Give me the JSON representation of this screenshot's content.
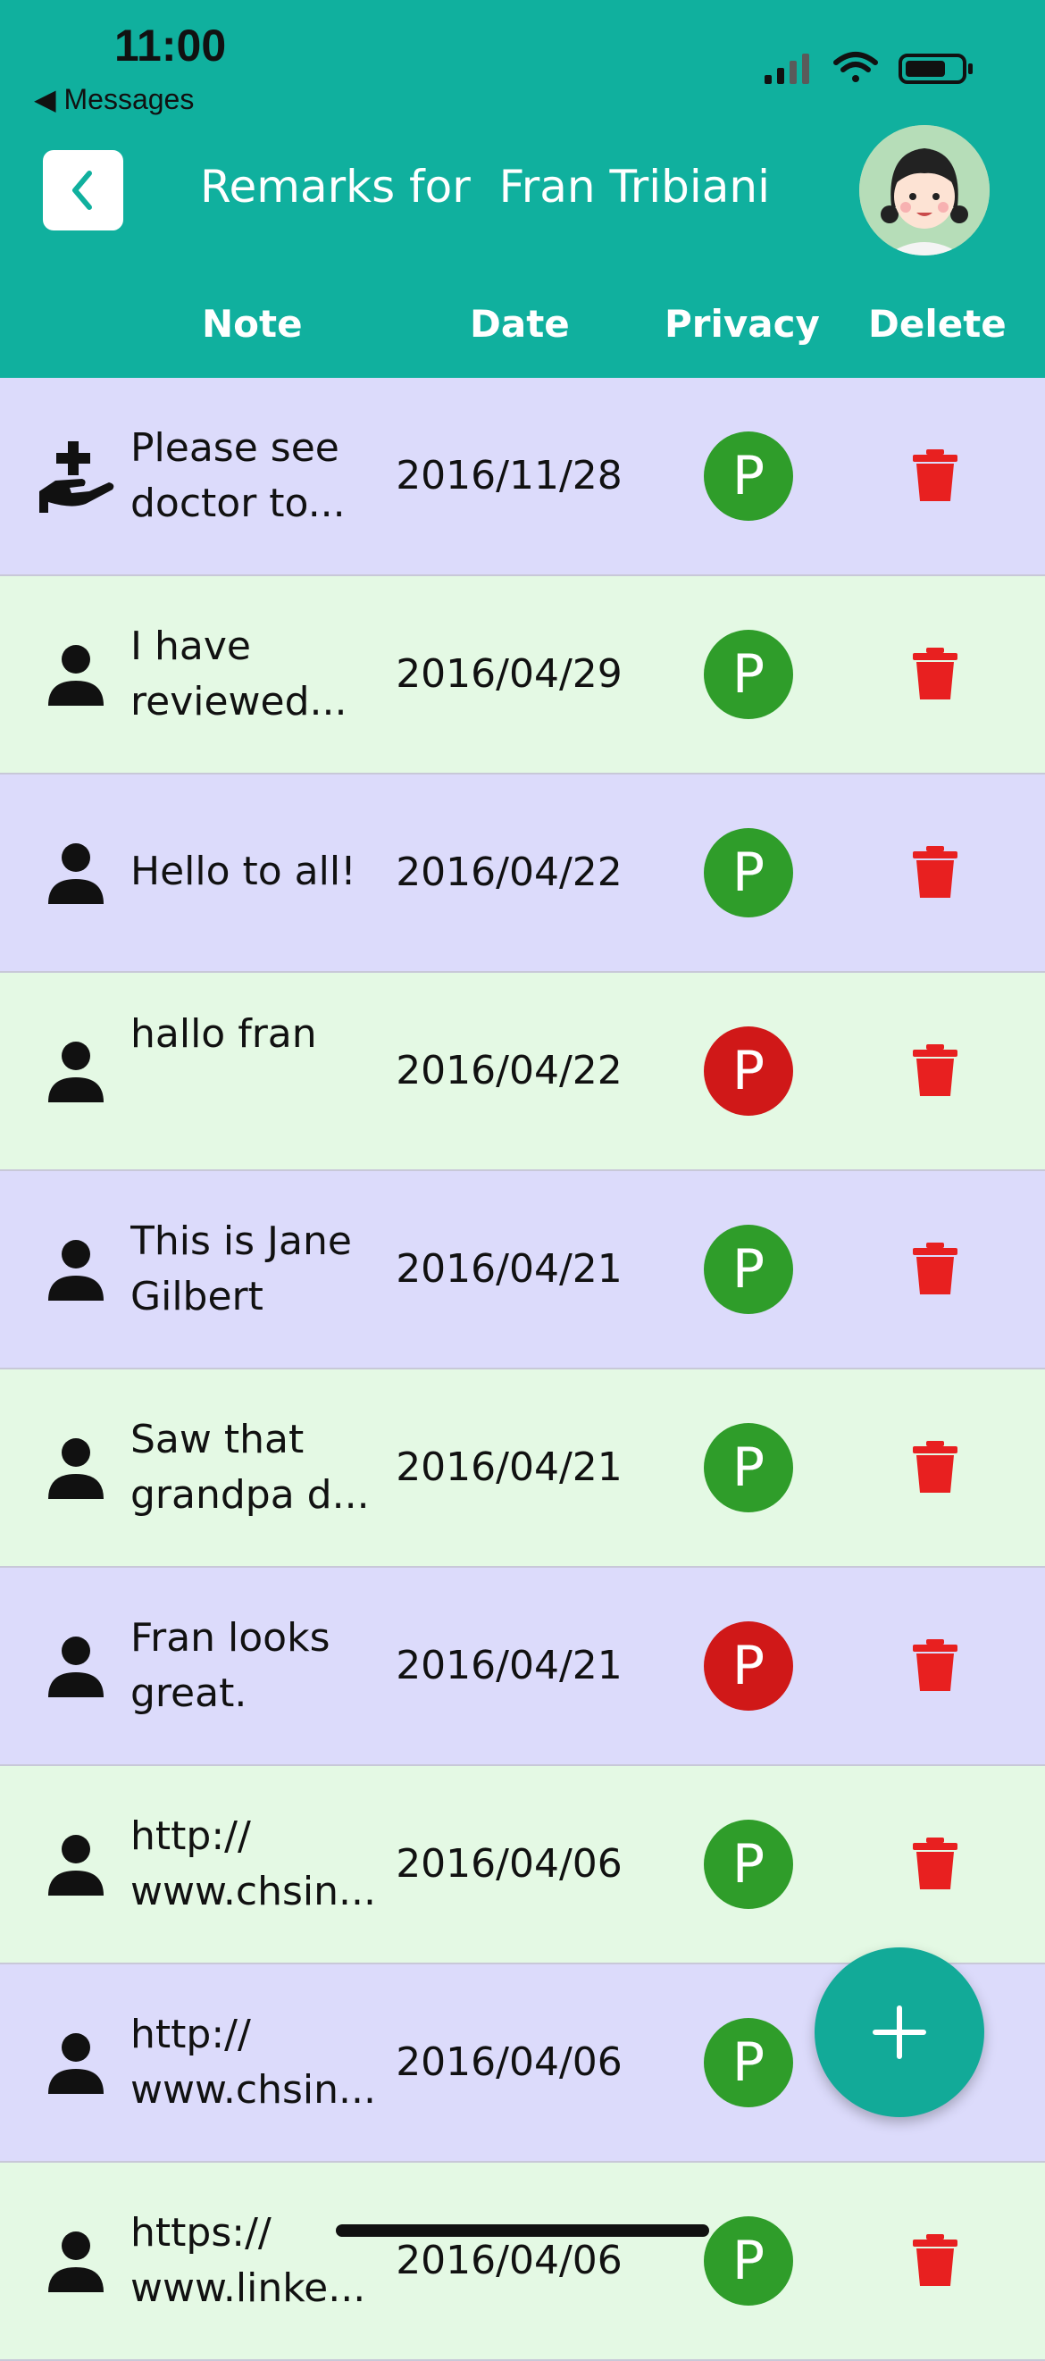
{
  "status_bar": {
    "time": "11:00",
    "back_app": "◀ Messages"
  },
  "header": {
    "title": "Remarks for  Fran Tribiani"
  },
  "columns": {
    "note": "Note",
    "date": "Date",
    "privacy": "Privacy",
    "delete": "Delete"
  },
  "colors": {
    "header": "#10b09e",
    "row_odd": "#dcdbfb",
    "row_even": "#e4f9e4",
    "privacy_public": "#2f9d2a",
    "privacy_private": "#d01818",
    "delete": "#e82020",
    "fab": "#12aa98"
  },
  "rows": [
    {
      "icon": "medical-hand-icon",
      "note_line1": "Please see",
      "note_line2": "doctor to...",
      "date": "2016/11/28",
      "privacy": "P",
      "privacy_state": "public"
    },
    {
      "icon": "person-icon",
      "note_line1": "I have",
      "note_line2": "reviewed...",
      "date": "2016/04/29",
      "privacy": "P",
      "privacy_state": "public"
    },
    {
      "icon": "person-icon",
      "note_line1": "Hello to all!",
      "note_line2": "",
      "date": "2016/04/22",
      "privacy": "P",
      "privacy_state": "public"
    },
    {
      "icon": "person-icon",
      "note_line1": "hallo fran",
      "note_line2": "",
      "date": "2016/04/22",
      "privacy": "P",
      "privacy_state": "private"
    },
    {
      "icon": "person-icon",
      "note_line1": "This is Jane",
      "note_line2": "Gilbert",
      "date": "2016/04/21",
      "privacy": "P",
      "privacy_state": "public"
    },
    {
      "icon": "person-icon",
      "note_line1": "Saw that",
      "note_line2": "grandpa d...",
      "date": "2016/04/21",
      "privacy": "P",
      "privacy_state": "public"
    },
    {
      "icon": "person-icon",
      "note_line1": "Fran looks",
      "note_line2": "great.",
      "date": "2016/04/21",
      "privacy": "P",
      "privacy_state": "private"
    },
    {
      "icon": "person-icon",
      "note_line1": "http://",
      "note_line2": "www.chsin...",
      "date": "2016/04/06",
      "privacy": "P",
      "privacy_state": "public"
    },
    {
      "icon": "person-icon",
      "note_line1": "http://",
      "note_line2": "www.chsin...",
      "date": "2016/04/06",
      "privacy": "P",
      "privacy_state": "public"
    },
    {
      "icon": "person-icon",
      "note_line1": "https://",
      "note_line2": "www.linke...",
      "date": "2016/04/06",
      "privacy": "P",
      "privacy_state": "public"
    }
  ],
  "fab": {
    "icon": "plus-icon"
  }
}
